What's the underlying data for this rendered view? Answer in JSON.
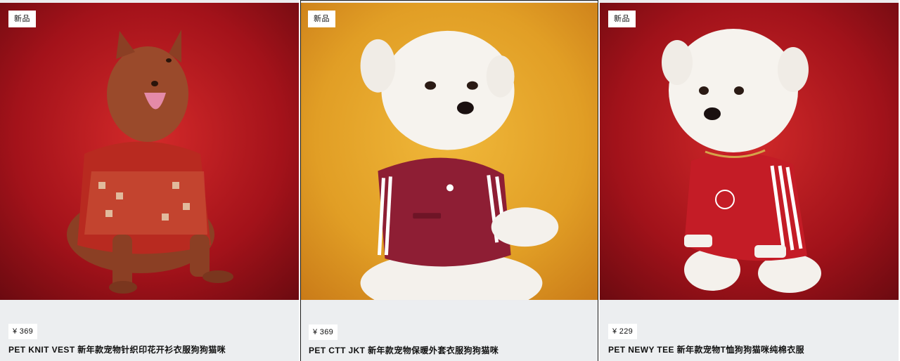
{
  "products": [
    {
      "badge": "新品",
      "price": "¥ 369",
      "title": "PET KNIT VEST 新年款宠物针织印花开衫衣服狗狗猫咪",
      "image_subject": "brown-dog-knit-vest",
      "bg_color": "#a8121a"
    },
    {
      "badge": "新品",
      "price": "¥ 369",
      "title": "PET CTT JKT 新年款宠物保暖外套衣服狗狗猫咪",
      "image_subject": "white-terrier-burgundy-jacket",
      "bg_color": "#e7a42a"
    },
    {
      "badge": "新品",
      "price": "¥ 229",
      "title": "PET NEWY TEE 新年款宠物T恤狗狗猫咪纯棉衣服",
      "image_subject": "white-terrier-red-tee",
      "bg_color": "#a8121a"
    }
  ]
}
